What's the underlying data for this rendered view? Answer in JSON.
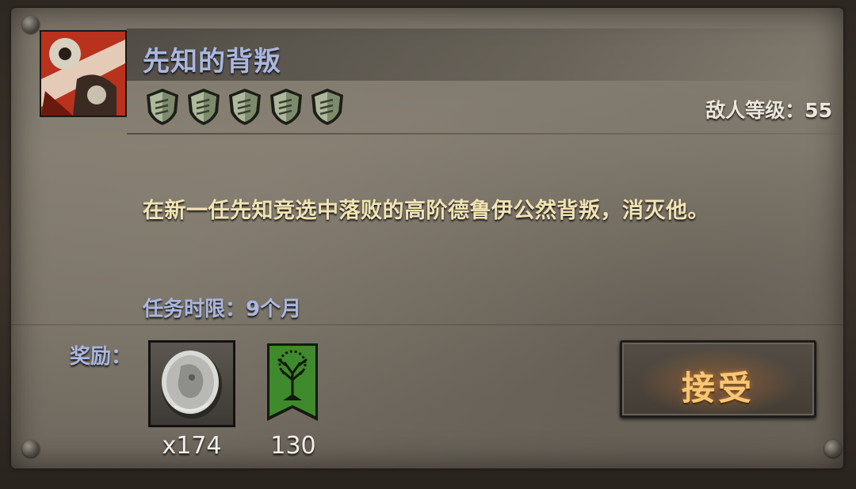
{
  "quest": {
    "title": "先知的背叛",
    "difficulty_shields": 5,
    "enemy_level_text": "敌人等级：55",
    "description": "在新一任先知竞选中落败的高阶德鲁伊公然背叛，消灭他。",
    "time_limit_text": "任务时限：9个月"
  },
  "rewards": {
    "label": "奖励：",
    "items": [
      {
        "icon": "silver-coin-icon",
        "count": "x174"
      },
      {
        "icon": "tree-banner-icon",
        "count": "130"
      }
    ]
  },
  "actions": {
    "accept_label": "接受"
  },
  "colors": {
    "title_blue": "#aab8e0",
    "description_cream": "#f1e3b3",
    "accept_gold": "#f7c775",
    "portrait_red": "#b8321e",
    "banner_green": "#3f8a2c"
  }
}
